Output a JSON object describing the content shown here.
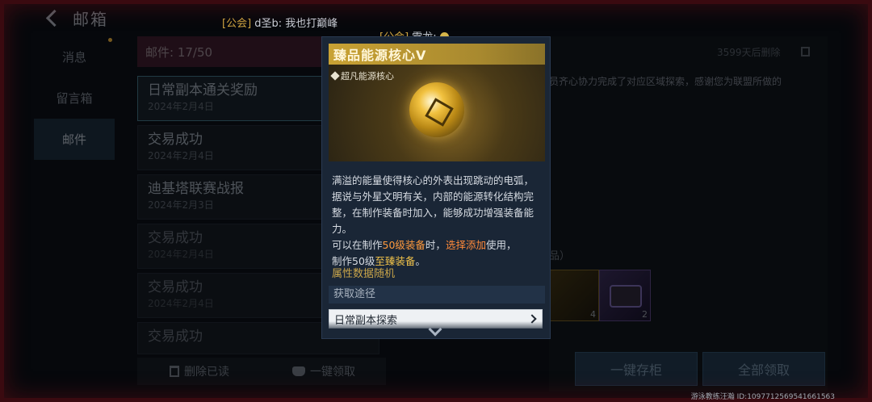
{
  "header": {
    "title": "邮箱"
  },
  "nav": {
    "items": [
      {
        "label": "消息",
        "active": false,
        "dot": true
      },
      {
        "label": "留言箱",
        "active": false,
        "dot": false
      },
      {
        "label": "邮件",
        "active": true,
        "dot": false
      }
    ]
  },
  "list": {
    "count_label": "邮件: 17/50",
    "mails": [
      {
        "title": "日常副本通关奖励",
        "date": "2024年2月4日",
        "state": "selected"
      },
      {
        "title": "交易成功",
        "date": "2024年2月4日",
        "state": "normal"
      },
      {
        "title": "迪基塔联赛战报",
        "date": "2024年2月3日",
        "state": "normal"
      },
      {
        "title": "交易成功",
        "date": "2024年2月4日",
        "state": "dim"
      },
      {
        "title": "交易成功",
        "date": "2024年2月4日",
        "state": "dim"
      },
      {
        "title": "交易成功",
        "date": "",
        "state": "dim"
      }
    ],
    "delete_read": "删除已读",
    "claim_one": "一键领取"
  },
  "detail": {
    "expire": "3599天后删除",
    "body_fragment": "员齐心协力完成了对应区域探索，感谢您为联盟所做的",
    "reward_label_fragment": "品）",
    "rewards": [
      {
        "count": "4"
      },
      {
        "count": "2"
      }
    ],
    "store_all": "一键存柜",
    "claim_all": "全部领取"
  },
  "chat": [
    {
      "tag": "[公会]",
      "text": " d圣b: 我也打巅峰"
    },
    {
      "tag": "[公会]",
      "text": " 雷龙: "
    }
  ],
  "card": {
    "title": "臻品能源核心Ⅴ",
    "quality": "超凡能源核心",
    "desc_1": "满溢的能量使得核心的外表出现跳动的电弧，据说与外星文明有关，内部的能源转化结构完整，在制作装备时加入，能够成功增强装备能力。",
    "desc_2a": "可以在制作",
    "desc_2b": "50级装备",
    "desc_2c": "时，",
    "desc_2d": "选择添加",
    "desc_2e": "使用，",
    "desc_3a": "制作50级",
    "desc_3b": "至臻装备",
    "desc_3c": "。",
    "attr": "属性数据随机",
    "obtain_header": "获取途径",
    "obtain_item": "日常副本探索"
  },
  "watermark": "游泳教练汪瀚  ID:1097712569541661563",
  "colors": {
    "accent_gold": "#c9a234",
    "highlight_orange": "#ff9a3d",
    "highlight_gold": "#f0c24a"
  }
}
